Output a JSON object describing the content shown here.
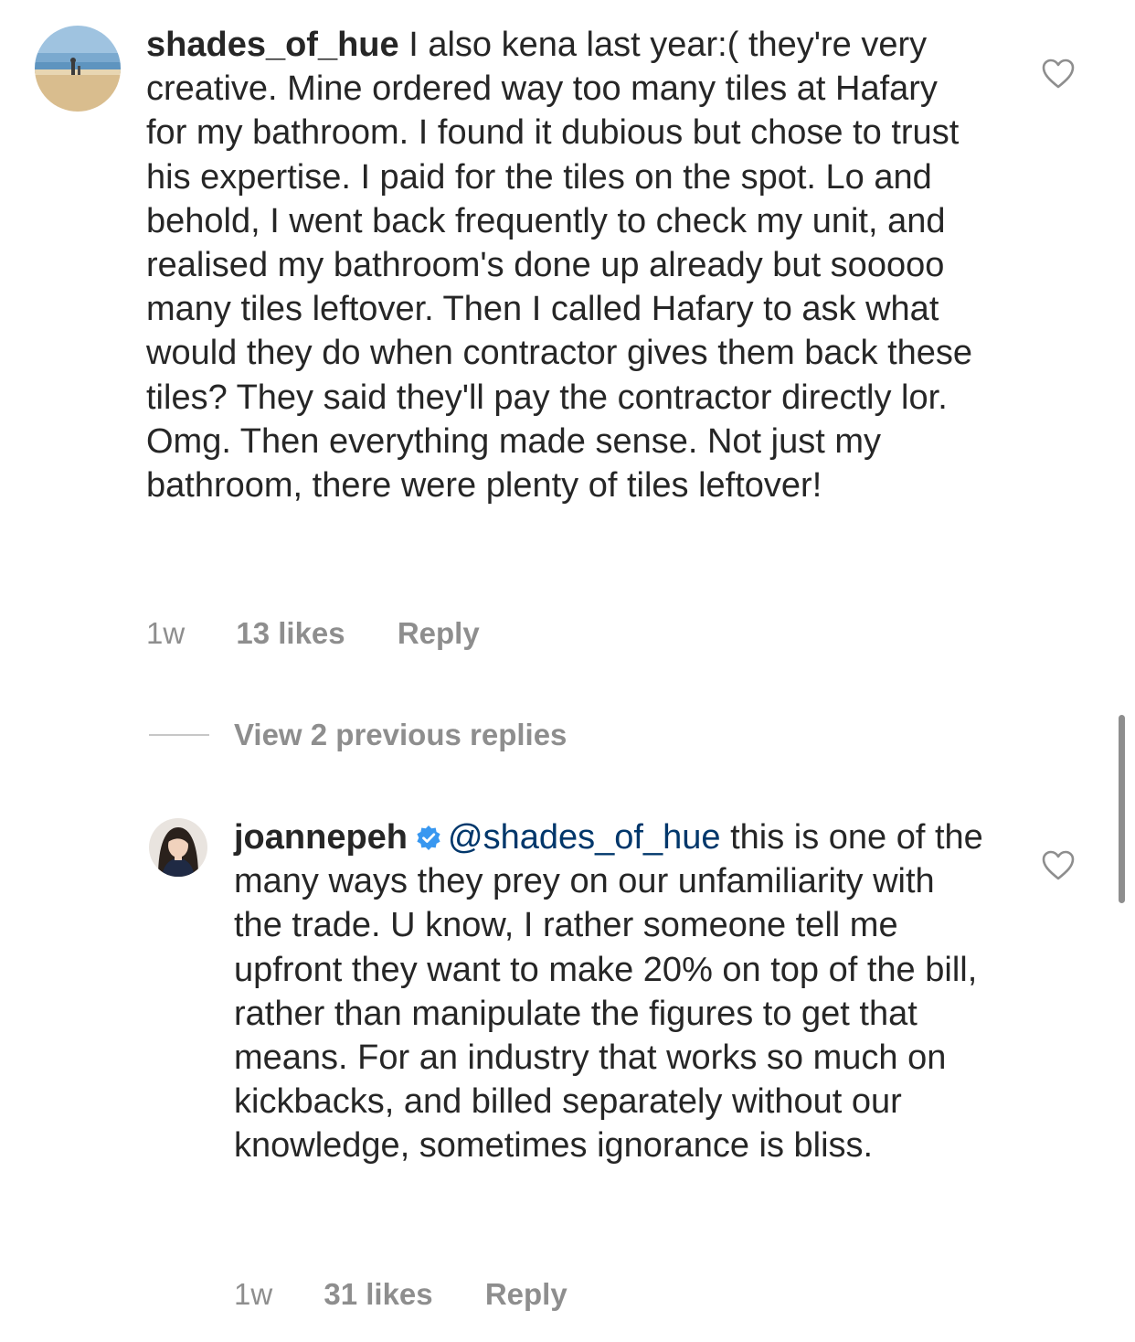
{
  "comments": [
    {
      "username": "shades_of_hue",
      "text": "I also kena last year:( they're very creative. Mine ordered way too many tiles at Hafary for my bathroom. I found it dubious but chose to trust his expertise. I paid for the tiles on the spot. Lo and behold, I went back frequently to check my unit, and realised my bathroom's done up already but sooooo many tiles leftover. Then I called Hafary to ask what would they do when contractor gives them back these tiles? They said they'll pay the contractor directly lor. Omg. Then everything made sense. Not just my bathroom, there were plenty of tiles leftover!",
      "time": "1w",
      "likes": "13 likes",
      "reply": "Reply",
      "avatar_icon": "beach-photo-avatar",
      "like_icon": "heart-outline-icon"
    }
  ],
  "view_replies": {
    "label": "View 2 previous replies"
  },
  "replies": [
    {
      "username": "joannepeh",
      "verified": true,
      "verified_icon": "verified-badge-icon",
      "verified_color": "#3897f0",
      "mention": "@shades_of_hue",
      "text": "this is one of the many ways they prey on our unfamiliarity with the trade. U know, I rather someone tell me upfront they want to make 20% on top of the bill, rather than manipulate the figures to get that means. For an industry that works so much on kickbacks, and billed separately without our knowledge, sometimes ignorance is bliss.",
      "time": "1w",
      "likes": "31 likes",
      "reply": "Reply",
      "avatar_icon": "portrait-photo-avatar",
      "like_icon": "heart-outline-icon"
    }
  ],
  "colors": {
    "text": "#262626",
    "secondary": "#8e8e8e",
    "mention": "#00376b",
    "verified": "#3897f0"
  }
}
